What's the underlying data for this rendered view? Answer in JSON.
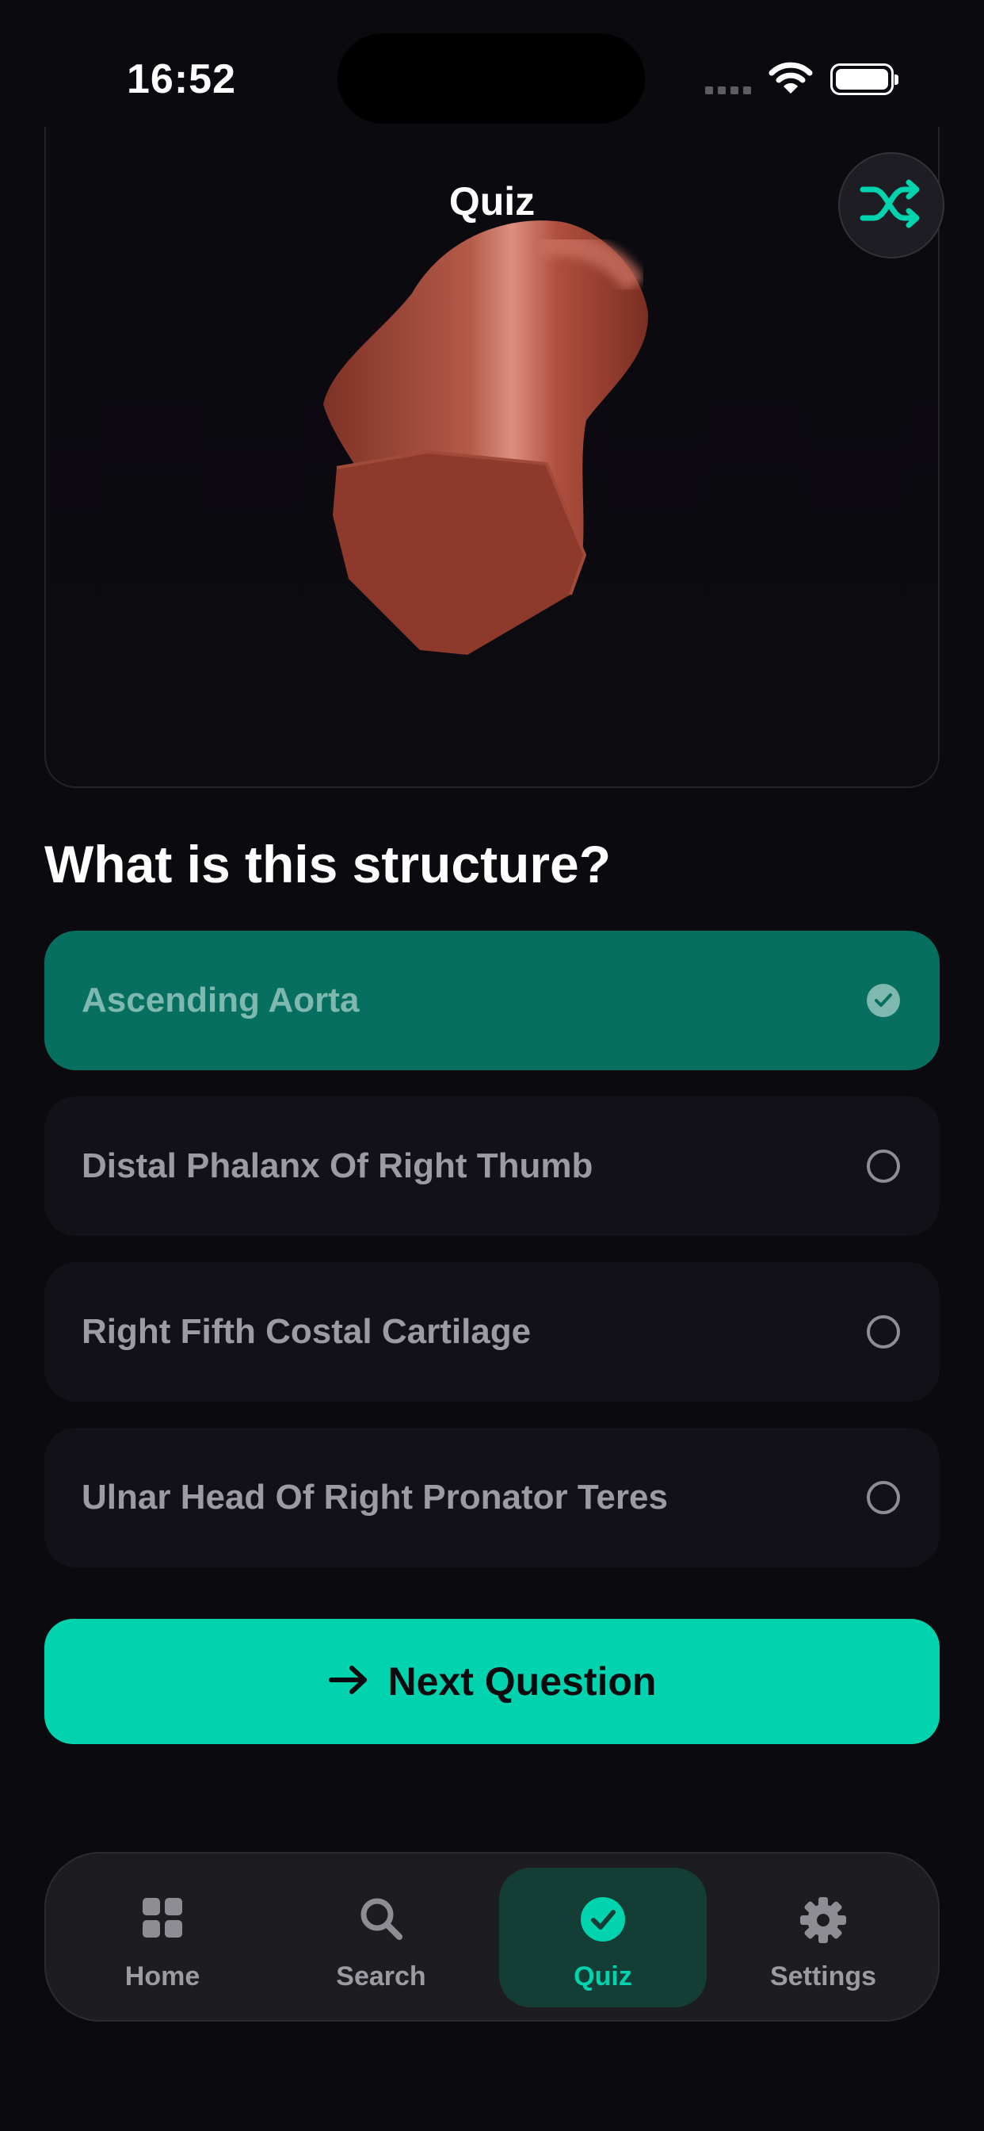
{
  "status_bar": {
    "time": "16:52"
  },
  "header": {
    "title": "Quiz",
    "shuffle_icon": "shuffle-icon"
  },
  "quiz": {
    "question": "What is this structure?",
    "options": [
      {
        "label": "Ascending Aorta",
        "selected": true
      },
      {
        "label": "Distal Phalanx Of Right Thumb",
        "selected": false
      },
      {
        "label": "Right Fifth Costal Cartilage",
        "selected": false
      },
      {
        "label": "Ulnar Head Of Right Pronator Teres",
        "selected": false
      }
    ],
    "next_button": "Next Question"
  },
  "tab_bar": {
    "items": [
      {
        "label": "Home",
        "icon": "grid-icon",
        "active": false
      },
      {
        "label": "Search",
        "icon": "search-icon",
        "active": false
      },
      {
        "label": "Quiz",
        "icon": "checkmark-circle-icon",
        "active": true
      },
      {
        "label": "Settings",
        "icon": "gear-icon",
        "active": false
      }
    ]
  },
  "colors": {
    "background": "#0b0a0f",
    "accent": "#00d3ad",
    "selected_option": "#066f5f",
    "option_background": "#121117",
    "model_color": "#a9483a"
  }
}
